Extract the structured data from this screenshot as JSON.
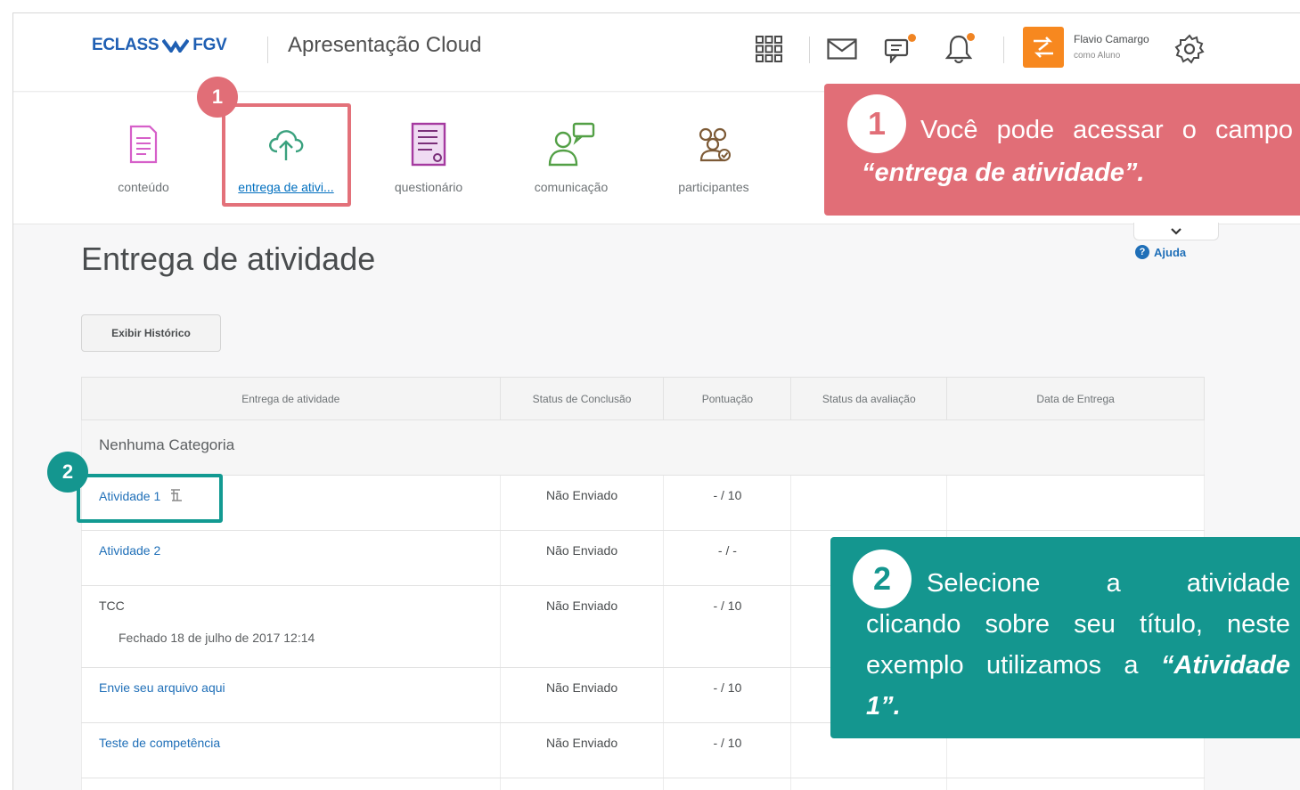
{
  "header": {
    "logo_left": "ECLASS",
    "logo_right": "FGV",
    "course_title": "Apresentação Cloud",
    "user_name": "Flavio Camargo",
    "user_role": "como Aluno"
  },
  "nav": {
    "items": [
      {
        "label": "conteúdo",
        "icon": "document-icon"
      },
      {
        "label": "entrega de ativi...",
        "icon": "cloud-upload-icon"
      },
      {
        "label": "questionário",
        "icon": "quiz-icon"
      },
      {
        "label": "comunicação",
        "icon": "communication-icon"
      },
      {
        "label": "participantes",
        "icon": "participants-icon"
      }
    ]
  },
  "page": {
    "title": "Entrega de atividade",
    "help_label": "Ajuda",
    "history_button": "Exibir Histórico"
  },
  "table": {
    "headers": [
      "Entrega de atividade",
      "Status de Conclusão",
      "Pontuação",
      "Status da avaliação",
      "Data de Entrega"
    ],
    "category": "Nenhuma Categoria",
    "rows": [
      {
        "name": "Atividade 1",
        "status": "Não Enviado",
        "score": "- / 10"
      },
      {
        "name": "Atividade 2",
        "status": "Não Enviado",
        "score": "- / -"
      },
      {
        "name": "TCC",
        "sub": "Fechado 18 de julho de 2017 12:14",
        "status": "Não Enviado",
        "score": "- / 10"
      },
      {
        "name": "Envie seu arquivo aqui",
        "status": "Não Enviado",
        "score": "- / 10"
      },
      {
        "name": "Teste de competência",
        "status": "Não Enviado",
        "score": "- / 10"
      }
    ]
  },
  "callouts": {
    "one": {
      "number": "1",
      "w1": "Você",
      "w2": "pode",
      "w3": "acessar",
      "w4": "o",
      "w5": "campo",
      "line2": "“entrega de atividade”."
    },
    "two": {
      "number": "2",
      "l1a": "Selecione",
      "l1b": "a",
      "l1c": "atividade",
      "l2a": "clicando",
      "l2b": "sobre",
      "l2c": "seu",
      "l2d": "título,",
      "l2e": "neste",
      "l3a": "exemplo",
      "l3b": "utilizamos",
      "l3c": "a",
      "l3d": "“Atividade",
      "l4": "1”."
    }
  },
  "colors": {
    "red": "#e16e77",
    "teal": "#14968f",
    "link": "#1f6fb8",
    "orange": "#f7881f"
  }
}
